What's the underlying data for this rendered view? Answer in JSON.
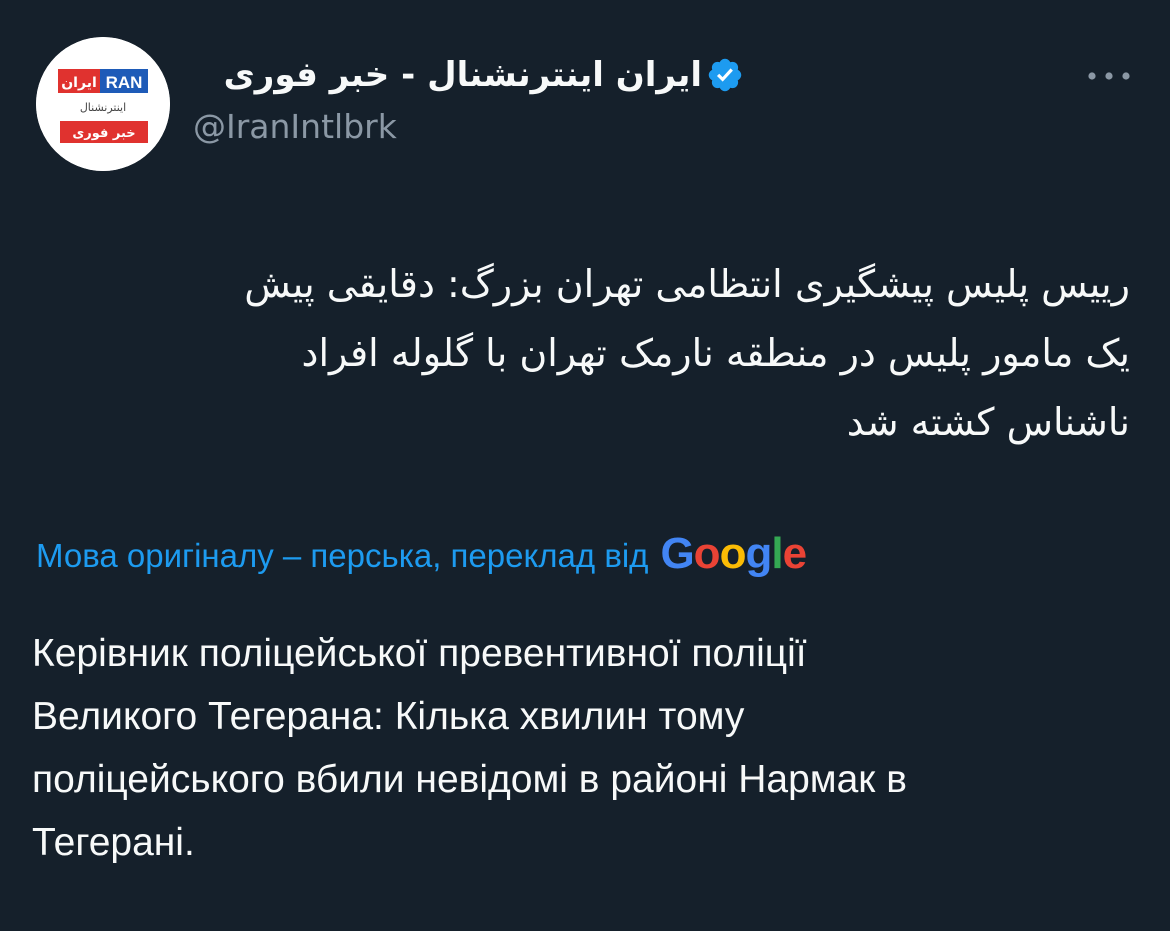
{
  "tweet": {
    "author": {
      "name": "ایران اینترنشنال - خبر فوری",
      "handle": "@IranIntlbrk",
      "verified": true,
      "avatar": {
        "logo_en": "RAN",
        "logo_fa": "ایران",
        "subtitle_fa": "اینترنشنال",
        "tag_fa": "خبر فوری"
      }
    },
    "more_icon": "more-horizontal-icon",
    "original_text_lines": [
      "رییس پلیس پیشگیری انتظامی تهران بزرگ: دقایقی پیش",
      "یک مامور پلیس در منطقه نارمک تهران با گلوله افراد",
      "ناشناس کشته شد"
    ],
    "translation_notice": "Мова оригіналу – перська, переклад від",
    "translation_provider": {
      "letters": [
        "G",
        "o",
        "o",
        "g",
        "l",
        "e"
      ]
    },
    "translated_text_lines": [
      "Керівник поліцейської превентивної поліції",
      "Великого Тегерана: Кілька хвилин тому",
      "поліцейського вбили невідомі в районі Нармак в",
      "Тегерані."
    ]
  },
  "colors": {
    "background": "#15202b",
    "text_primary": "#f7f9f9",
    "text_secondary": "#8b98a5",
    "link": "#1d9bf0",
    "verified_badge": "#1d9bf0",
    "logo_red": "#e0322f",
    "logo_blue": "#1e5bb8"
  }
}
